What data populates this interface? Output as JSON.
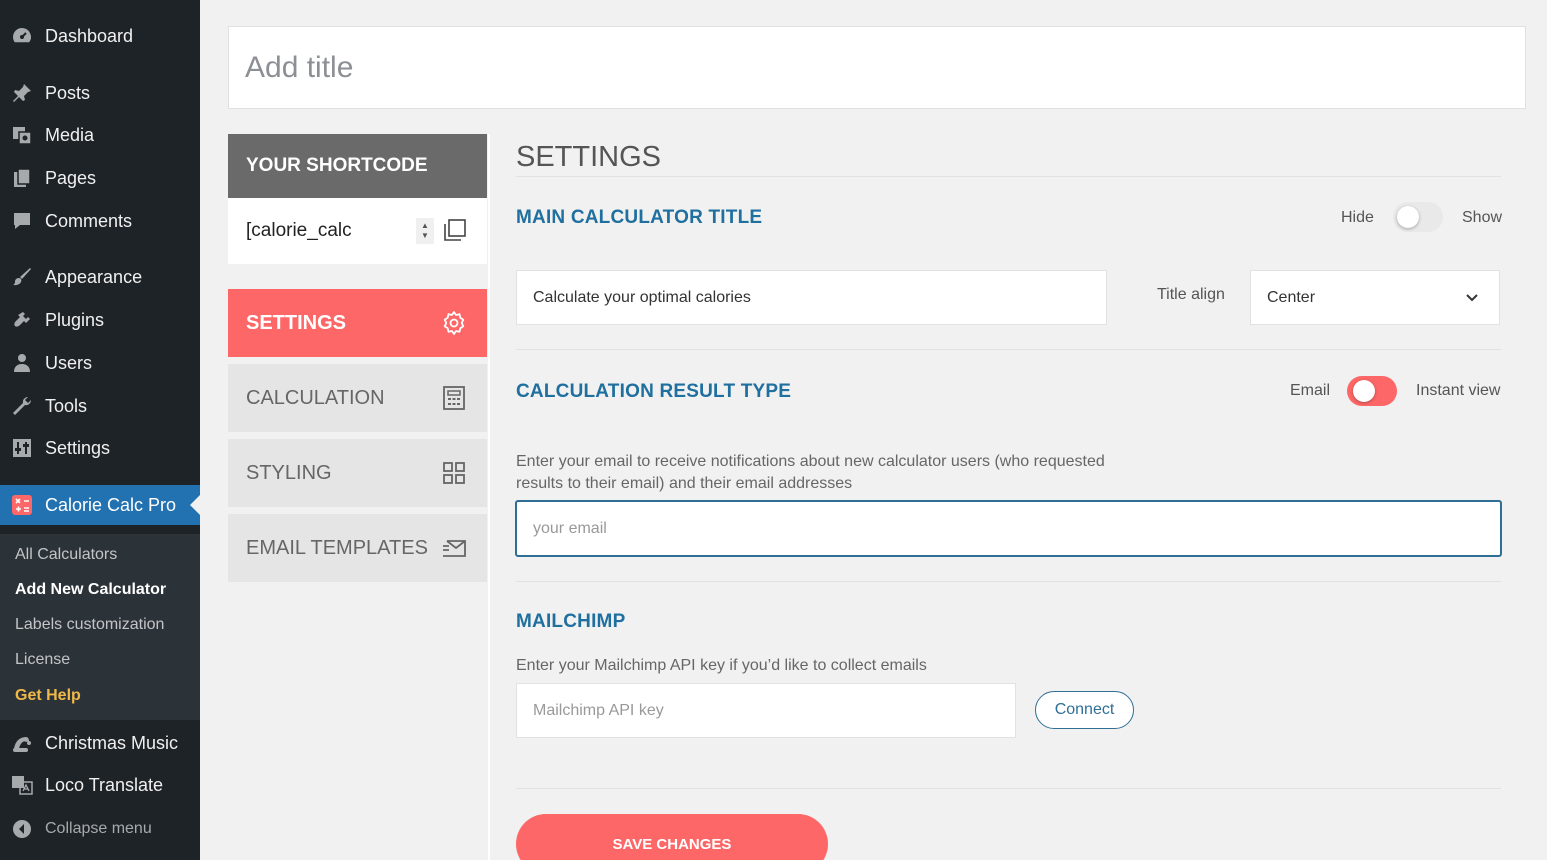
{
  "sidebar": {
    "items": [
      {
        "label": "Dashboard",
        "icon": "dashboard-icon"
      },
      {
        "label": "Posts",
        "icon": "pin-icon"
      },
      {
        "label": "Media",
        "icon": "media-icon"
      },
      {
        "label": "Pages",
        "icon": "pages-icon"
      },
      {
        "label": "Comments",
        "icon": "comment-icon"
      },
      {
        "label": "Appearance",
        "icon": "brush-icon"
      },
      {
        "label": "Plugins",
        "icon": "plug-icon"
      },
      {
        "label": "Users",
        "icon": "user-icon"
      },
      {
        "label": "Tools",
        "icon": "wrench-icon"
      },
      {
        "label": "Settings",
        "icon": "settings-sliders-icon"
      },
      {
        "label": "Calorie Calc Pro",
        "icon": "calculator-icon"
      },
      {
        "label": "Christmas Music",
        "icon": "santa-hat-icon"
      },
      {
        "label": "Loco Translate",
        "icon": "translate-icon"
      }
    ],
    "submenu": [
      "All Calculators",
      "Add New Calculator",
      "Labels customization",
      "License",
      "Get Help"
    ],
    "collapse_label": "Collapse menu"
  },
  "editor": {
    "title_placeholder": "Add title"
  },
  "left_panel": {
    "shortcode_heading": "YOUR SHORTCODE",
    "shortcode_value": "[calorie_calc",
    "nav": [
      "SETTINGS",
      "CALCULATION",
      "STYLING",
      "EMAIL TEMPLATES"
    ]
  },
  "settings": {
    "heading": "SETTINGS",
    "main_title_label": "MAIN CALCULATOR TITLE",
    "hide_label": "Hide",
    "show_label": "Show",
    "title_value": "Calculate your optimal calories",
    "title_align_label": "Title align",
    "title_align_value": "Center",
    "result_type_label": "CALCULATION RESULT TYPE",
    "email_label": "Email",
    "instant_view_label": "Instant view",
    "email_desc_line1": "Enter your email to receive notifications about new calculator users (who requested",
    "email_desc_line2": "results to their email) and their email addresses",
    "email_placeholder": "your email",
    "mailchimp_label": "MAILCHIMP",
    "mailchimp_desc": "Enter your Mailchimp API key if you’d like to collect emails",
    "mailchimp_placeholder": "Mailchimp API key",
    "connect_label": "Connect",
    "save_label": "SAVE CHANGES"
  },
  "colors": {
    "sidebar_bg": "#1d2327",
    "active_menu": "#2271b1",
    "accent": "#fd6767",
    "section_title": "#1f6f9f"
  }
}
